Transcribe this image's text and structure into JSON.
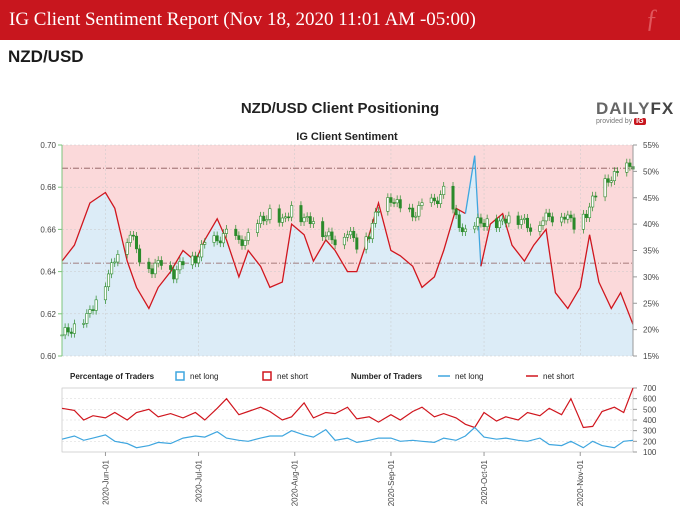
{
  "header": {
    "title": "IG Client Sentiment Report (Nov 18, 2020 11:01 AM -05:00)",
    "pair": "NZD/USD"
  },
  "logo": {
    "brand_a": "DAILY",
    "brand_b": "FX",
    "provided_by": "provided by",
    "ig": "IG"
  },
  "chart_data": [
    {
      "type": "line",
      "title": "NZD/USD Client Positioning",
      "subtitle": "IG Client Sentiment",
      "left_axis": {
        "ticks": [
          "0.60",
          "0.62",
          "0.64",
          "0.66",
          "0.68",
          "0.70"
        ],
        "range": [
          0.6,
          0.7
        ]
      },
      "right_axis": {
        "ticks": [
          "15%",
          "20%",
          "25%",
          "30%",
          "35%",
          "40%",
          "45%",
          "50%",
          "55%"
        ],
        "range": [
          15,
          55
        ]
      },
      "x_ticks": [
        "2020-Jun-01",
        "2020-Jul-01",
        "2020-Aug-01",
        "2020-Sep-01",
        "2020-Oct-01",
        "2020-Nov-01"
      ],
      "x_range": [
        "2020-05-18",
        "2020-11-18"
      ],
      "reference_lines": [
        0.689,
        0.644
      ],
      "colors": {
        "net_short_fill": "#fbd9da",
        "net_long_fill": "#dcecf7",
        "net_short_line": "#d0161e",
        "net_long_line": "#3fa6df",
        "candle": "#2a8a2a"
      },
      "net_long_pct": [
        [
          "2020-05-18",
          33
        ],
        [
          "2020-05-22",
          36
        ],
        [
          "2020-05-27",
          44
        ],
        [
          "2020-06-01",
          46
        ],
        [
          "2020-06-04",
          43
        ],
        [
          "2020-06-08",
          33
        ],
        [
          "2020-06-11",
          28
        ],
        [
          "2020-06-15",
          24
        ],
        [
          "2020-06-18",
          28
        ],
        [
          "2020-06-22",
          31
        ],
        [
          "2020-06-26",
          35
        ],
        [
          "2020-06-30",
          33
        ],
        [
          "2020-07-03",
          37
        ],
        [
          "2020-07-07",
          41
        ],
        [
          "2020-07-10",
          37
        ],
        [
          "2020-07-14",
          30
        ],
        [
          "2020-07-17",
          35
        ],
        [
          "2020-07-21",
          32
        ],
        [
          "2020-07-24",
          28
        ],
        [
          "2020-07-28",
          29
        ],
        [
          "2020-07-31",
          40
        ],
        [
          "2020-08-04",
          38
        ],
        [
          "2020-08-07",
          33
        ],
        [
          "2020-08-11",
          37
        ],
        [
          "2020-08-14",
          35
        ],
        [
          "2020-08-18",
          31
        ],
        [
          "2020-08-21",
          31
        ],
        [
          "2020-08-25",
          38
        ],
        [
          "2020-08-28",
          44
        ],
        [
          "2020-09-01",
          35
        ],
        [
          "2020-09-04",
          34
        ],
        [
          "2020-09-08",
          32
        ],
        [
          "2020-09-11",
          28
        ],
        [
          "2020-09-15",
          30
        ],
        [
          "2020-09-18",
          35
        ],
        [
          "2020-09-22",
          43
        ],
        [
          "2020-09-25",
          42
        ],
        [
          "2020-09-28",
          53
        ],
        [
          "2020-09-30",
          32
        ],
        [
          "2020-10-03",
          40
        ],
        [
          "2020-10-07",
          42
        ],
        [
          "2020-10-10",
          36
        ],
        [
          "2020-10-14",
          33
        ],
        [
          "2020-10-17",
          36
        ],
        [
          "2020-10-21",
          39
        ],
        [
          "2020-10-24",
          27
        ],
        [
          "2020-10-28",
          24
        ],
        [
          "2020-11-01",
          28
        ],
        [
          "2020-11-04",
          38
        ],
        [
          "2020-11-07",
          29
        ],
        [
          "2020-11-11",
          24
        ],
        [
          "2020-11-14",
          27
        ],
        [
          "2020-11-18",
          21
        ]
      ],
      "price_close": [
        [
          "2020-05-18",
          0.61
        ],
        [
          "2020-05-22",
          0.614
        ],
        [
          "2020-05-26",
          0.618
        ],
        [
          "2020-05-29",
          0.627
        ],
        [
          "2020-06-02",
          0.638
        ],
        [
          "2020-06-05",
          0.65
        ],
        [
          "2020-06-09",
          0.658
        ],
        [
          "2020-06-12",
          0.647
        ],
        [
          "2020-06-16",
          0.641
        ],
        [
          "2020-06-19",
          0.645
        ],
        [
          "2020-06-23",
          0.639
        ],
        [
          "2020-06-26",
          0.644
        ],
        [
          "2020-06-30",
          0.646
        ],
        [
          "2020-07-03",
          0.653
        ],
        [
          "2020-07-07",
          0.655
        ],
        [
          "2020-07-10",
          0.658
        ],
        [
          "2020-07-14",
          0.654
        ],
        [
          "2020-07-17",
          0.656
        ],
        [
          "2020-07-21",
          0.664
        ],
        [
          "2020-07-24",
          0.668
        ],
        [
          "2020-07-28",
          0.663
        ],
        [
          "2020-07-31",
          0.671
        ],
        [
          "2020-08-04",
          0.664
        ],
        [
          "2020-08-07",
          0.665
        ],
        [
          "2020-08-11",
          0.657
        ],
        [
          "2020-08-14",
          0.655
        ],
        [
          "2020-08-18",
          0.659
        ],
        [
          "2020-08-21",
          0.653
        ],
        [
          "2020-08-25",
          0.658
        ],
        [
          "2020-08-28",
          0.67
        ],
        [
          "2020-09-01",
          0.675
        ],
        [
          "2020-09-04",
          0.67
        ],
        [
          "2020-09-08",
          0.667
        ],
        [
          "2020-09-11",
          0.671
        ],
        [
          "2020-09-15",
          0.673
        ],
        [
          "2020-09-18",
          0.678
        ],
        [
          "2020-09-22",
          0.665
        ],
        [
          "2020-09-25",
          0.658
        ],
        [
          "2020-09-29",
          0.663
        ],
        [
          "2020-10-02",
          0.664
        ],
        [
          "2020-10-06",
          0.662
        ],
        [
          "2020-10-09",
          0.667
        ],
        [
          "2020-10-13",
          0.664
        ],
        [
          "2020-10-16",
          0.661
        ],
        [
          "2020-10-20",
          0.665
        ],
        [
          "2020-10-23",
          0.666
        ],
        [
          "2020-10-27",
          0.667
        ],
        [
          "2020-10-30",
          0.662
        ],
        [
          "2020-11-03",
          0.668
        ],
        [
          "2020-11-06",
          0.676
        ],
        [
          "2020-11-10",
          0.684
        ],
        [
          "2020-11-13",
          0.686
        ],
        [
          "2020-11-18",
          0.691
        ]
      ]
    },
    {
      "type": "line",
      "legend": {
        "pct_title": "Percentage of Traders",
        "pct_long": "net long",
        "pct_short": "net short",
        "num_title": "Number of Traders",
        "num_long": "net long",
        "num_short": "net short"
      },
      "y_ticks": [
        "100",
        "200",
        "300",
        "400",
        "500",
        "600",
        "700"
      ],
      "y_range": [
        100,
        700
      ],
      "net_short": [
        [
          "2020-05-18",
          510
        ],
        [
          "2020-05-22",
          490
        ],
        [
          "2020-05-25",
          400
        ],
        [
          "2020-05-28",
          440
        ],
        [
          "2020-06-01",
          420
        ],
        [
          "2020-06-04",
          470
        ],
        [
          "2020-06-08",
          400
        ],
        [
          "2020-06-11",
          470
        ],
        [
          "2020-06-15",
          500
        ],
        [
          "2020-06-18",
          430
        ],
        [
          "2020-06-22",
          460
        ],
        [
          "2020-06-26",
          420
        ],
        [
          "2020-06-30",
          470
        ],
        [
          "2020-07-03",
          400
        ],
        [
          "2020-07-07",
          510
        ],
        [
          "2020-07-10",
          600
        ],
        [
          "2020-07-14",
          450
        ],
        [
          "2020-07-17",
          480
        ],
        [
          "2020-07-21",
          520
        ],
        [
          "2020-07-24",
          480
        ],
        [
          "2020-07-28",
          400
        ],
        [
          "2020-07-31",
          430
        ],
        [
          "2020-08-04",
          560
        ],
        [
          "2020-08-07",
          420
        ],
        [
          "2020-08-11",
          470
        ],
        [
          "2020-08-14",
          460
        ],
        [
          "2020-08-18",
          520
        ],
        [
          "2020-08-21",
          410
        ],
        [
          "2020-08-25",
          430
        ],
        [
          "2020-08-28",
          380
        ],
        [
          "2020-09-01",
          450
        ],
        [
          "2020-09-04",
          400
        ],
        [
          "2020-09-08",
          480
        ],
        [
          "2020-09-11",
          520
        ],
        [
          "2020-09-15",
          430
        ],
        [
          "2020-09-18",
          460
        ],
        [
          "2020-09-22",
          420
        ],
        [
          "2020-09-25",
          360
        ],
        [
          "2020-09-28",
          330
        ],
        [
          "2020-10-01",
          470
        ],
        [
          "2020-10-05",
          390
        ],
        [
          "2020-10-08",
          430
        ],
        [
          "2020-10-12",
          400
        ],
        [
          "2020-10-15",
          470
        ],
        [
          "2020-10-19",
          440
        ],
        [
          "2020-10-22",
          510
        ],
        [
          "2020-10-26",
          450
        ],
        [
          "2020-10-29",
          600
        ],
        [
          "2020-11-02",
          330
        ],
        [
          "2020-11-05",
          340
        ],
        [
          "2020-11-08",
          480
        ],
        [
          "2020-11-12",
          520
        ],
        [
          "2020-11-15",
          470
        ],
        [
          "2020-11-18",
          700
        ]
      ],
      "net_long": [
        [
          "2020-05-18",
          220
        ],
        [
          "2020-05-22",
          250
        ],
        [
          "2020-05-25",
          210
        ],
        [
          "2020-05-28",
          230
        ],
        [
          "2020-06-01",
          260
        ],
        [
          "2020-06-04",
          200
        ],
        [
          "2020-06-08",
          180
        ],
        [
          "2020-06-11",
          140
        ],
        [
          "2020-06-15",
          160
        ],
        [
          "2020-06-18",
          190
        ],
        [
          "2020-06-22",
          180
        ],
        [
          "2020-06-26",
          230
        ],
        [
          "2020-06-30",
          250
        ],
        [
          "2020-07-03",
          240
        ],
        [
          "2020-07-07",
          290
        ],
        [
          "2020-07-10",
          230
        ],
        [
          "2020-07-14",
          210
        ],
        [
          "2020-07-17",
          200
        ],
        [
          "2020-07-21",
          230
        ],
        [
          "2020-07-24",
          250
        ],
        [
          "2020-07-28",
          250
        ],
        [
          "2020-07-31",
          300
        ],
        [
          "2020-08-04",
          260
        ],
        [
          "2020-08-07",
          240
        ],
        [
          "2020-08-11",
          310
        ],
        [
          "2020-08-14",
          210
        ],
        [
          "2020-08-18",
          230
        ],
        [
          "2020-08-21",
          190
        ],
        [
          "2020-08-25",
          210
        ],
        [
          "2020-08-28",
          230
        ],
        [
          "2020-09-01",
          230
        ],
        [
          "2020-09-04",
          200
        ],
        [
          "2020-09-08",
          210
        ],
        [
          "2020-09-11",
          200
        ],
        [
          "2020-09-15",
          190
        ],
        [
          "2020-09-18",
          230
        ],
        [
          "2020-09-22",
          210
        ],
        [
          "2020-09-25",
          250
        ],
        [
          "2020-09-28",
          330
        ],
        [
          "2020-10-01",
          240
        ],
        [
          "2020-10-05",
          220
        ],
        [
          "2020-10-08",
          230
        ],
        [
          "2020-10-12",
          210
        ],
        [
          "2020-10-15",
          200
        ],
        [
          "2020-10-19",
          230
        ],
        [
          "2020-10-22",
          170
        ],
        [
          "2020-10-26",
          160
        ],
        [
          "2020-10-29",
          200
        ],
        [
          "2020-11-02",
          140
        ],
        [
          "2020-11-05",
          200
        ],
        [
          "2020-11-08",
          160
        ],
        [
          "2020-11-12",
          140
        ],
        [
          "2020-11-15",
          200
        ],
        [
          "2020-11-18",
          210
        ]
      ]
    }
  ]
}
